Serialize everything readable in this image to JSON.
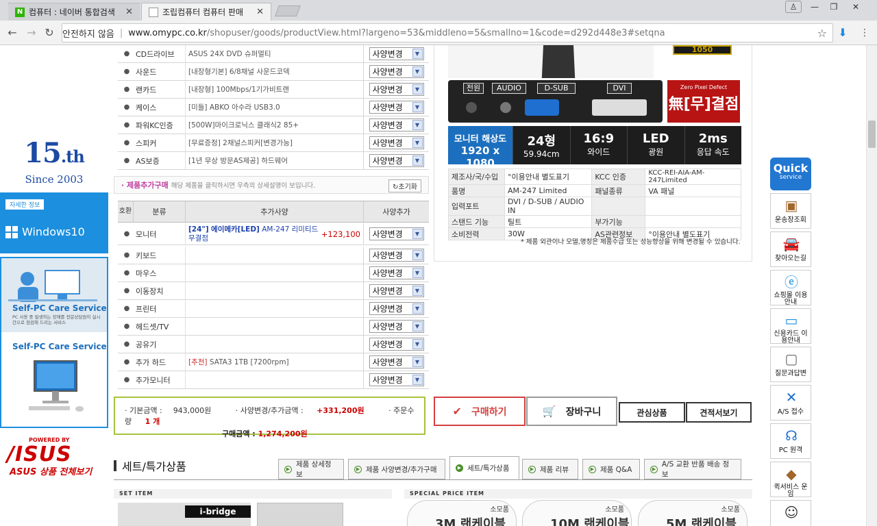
{
  "browser": {
    "tabs": [
      {
        "title": "컴퓨터 : 네이버 통합검색"
      },
      {
        "title": "조립컴퓨터 컴퓨터 판매"
      }
    ],
    "omnibox": {
      "insecure_label": "안전하지 않음",
      "host": "www.omypc.co.kr",
      "path": "/shopuser/goods/productView.html?largeno=53&middleno=5&smallno=1&code=d292d448e3#setqna"
    }
  },
  "left_banners": {
    "anniv_num": "15",
    "anniv_suffix": ".th",
    "since": "Since 2003",
    "win_tag": "자세한 정보",
    "win_logo": "Windows10",
    "selfpc_title": "Self-PC Care Service",
    "selfpc_sub": "PC 사용 중 발생하는 장애를 전문상담원이 실시간으로 점검해 드리는 서비스",
    "selfpc_title2": "Self-PC Care Service",
    "asus_powered": "POWERED BY",
    "asus_word": "/ISUS",
    "asus_caption": "ASUS 상품 전체보기"
  },
  "spec_rows": [
    {
      "cat": "CD드라이브",
      "desc": "ASUS 24X DVD 슈퍼멀티",
      "opt": "사양변경"
    },
    {
      "cat": "사운드",
      "desc": "[내장형기본] 6/8채널 사운드코덱",
      "opt": "사양변경"
    },
    {
      "cat": "랜카드",
      "desc": "[내장형] 100Mbps/1기가비트랜",
      "opt": "사양변경"
    },
    {
      "cat": "케이스",
      "desc": "[미들] ABKO 아수라 USB3.0",
      "opt": "사양변경"
    },
    {
      "cat": "파워KC인증",
      "desc": "[500W]마이크로닉스 클래식2 85+",
      "opt": "사양변경"
    },
    {
      "cat": "스피커",
      "desc": "[무료증정] 2채널스피커[변경가능]",
      "opt": "사양변경"
    },
    {
      "cat": "AS보증",
      "desc": "[1년 무상 방문AS제공] 하드웨어",
      "opt": "사양변경"
    }
  ],
  "add_section": {
    "title": "· 제품추가구매",
    "subtitle": "해당 제품을 클릭하시면 우측의 상세설명이 보입니다.",
    "reset": "↻초기화",
    "head": {
      "no": "호환",
      "cat": "분류",
      "spec": "추가사양",
      "opt": "사양추가"
    },
    "monitor": {
      "cat": "모니터",
      "b1": "[24\"]",
      "b2": "에이메카",
      "b3": "[LED]",
      "name": "AM-247 리미티드 무결점",
      "price": "+123,100",
      "opt": "사양변경"
    },
    "rows": [
      {
        "cat": "키보드",
        "opt": "사양변경"
      },
      {
        "cat": "마우스",
        "opt": "사양변경"
      },
      {
        "cat": "이동장치",
        "opt": "사양변경"
      },
      {
        "cat": "프린터",
        "opt": "사양변경"
      },
      {
        "cat": "헤드셋/TV",
        "opt": "사양변경"
      },
      {
        "cat": "공유기",
        "opt": "사양변경"
      }
    ],
    "hdd": {
      "cat": "추가 하드",
      "tag": "[추천]",
      "desc": "SATA3 1TB [7200rpm]",
      "opt": "사양변경"
    },
    "extra_monitor": {
      "cat": "추가모니터",
      "opt": "사양변경"
    }
  },
  "summary": {
    "base_label": "· 기본금액 :",
    "base": "943,000원",
    "change_label": "· 사양변경/추가금액 :",
    "change": "+331,200원",
    "qty_label": "· 주문수량",
    "qty": "1 개",
    "total_label": "구매금액 :",
    "total": "1,274,200원"
  },
  "buttons": {
    "buy": "구매하기",
    "cart": "장바구니",
    "wish": "관심상품",
    "quote": "견적서보기"
  },
  "product": {
    "badge": "1050",
    "ports": [
      "전원",
      "AUDIO",
      "D-SUB",
      "DVI"
    ],
    "zero_pixel": "Zero Pixel Defect",
    "zero_pixel_big": "無[무]결점",
    "res_label": "모니터 해상도",
    "res_value": "1920 x 1080",
    "specs": [
      {
        "a": "24형",
        "b": "59.94cm"
      },
      {
        "a": "16:9",
        "b": "와이드"
      },
      {
        "a": "LED",
        "b": "광원"
      },
      {
        "a": "2ms",
        "b": "응답 속도"
      }
    ],
    "info": [
      [
        "제조사/국/수입",
        "°이용안내 별도표기",
        "KCC 인증",
        "KCC-REI-AIA-AM-247Limited"
      ],
      [
        "품명",
        "AM-247 Limited",
        "패널종류",
        "VA 패널"
      ],
      [
        "입력포트",
        "DVI / D-SUB / AUDIO IN",
        "",
        ""
      ],
      [
        "스탠드 기능",
        "틸트",
        "부가기능",
        ""
      ],
      [
        "소비전력",
        "30W",
        "AS관련정보",
        "°이용안내 별도표기"
      ]
    ],
    "note": "* 제품 외관이나 모델,명칭은 제품수급 또는 성능향상을 위해 변경될 수 있습니다."
  },
  "bottom": {
    "section_title": "세트/특가상품",
    "tabs": [
      "제품 상세정보",
      "제품 사양변경/추가구매",
      "세트/특가상품",
      "제품 리뷰",
      "제품 Q&A",
      "A/S 교환 반품 배송 정보"
    ],
    "set_label": "SET ITEM",
    "special_label": "SPECIAL PRICE ITEM",
    "ibridge": "i-bridge",
    "sp_items": [
      {
        "cat": "소모품",
        "big": "3M 랜케이블"
      },
      {
        "cat": "소모품",
        "big": "10M 랜케이블"
      },
      {
        "cat": "소모품",
        "big": "5M 랜케이블"
      }
    ]
  },
  "quick_menu": {
    "quick_title": "Quick",
    "quick_sub": "service",
    "items": [
      {
        "label": "운송장조회",
        "icon": "box-icon"
      },
      {
        "label": "찾아오는길",
        "icon": "car-icon"
      },
      {
        "label": "쇼핑몰 이용안내",
        "icon": "ie-icon"
      },
      {
        "label": "신용카드 이용안내",
        "icon": "card-icon"
      },
      {
        "label": "질문과답변",
        "icon": "monitor-icon"
      },
      {
        "label": "A/S 접수",
        "icon": "tools-icon"
      },
      {
        "label": "PC 원격",
        "icon": "headset-icon"
      },
      {
        "label": "퀵서비스 운임",
        "icon": "delivery-icon"
      }
    ]
  }
}
